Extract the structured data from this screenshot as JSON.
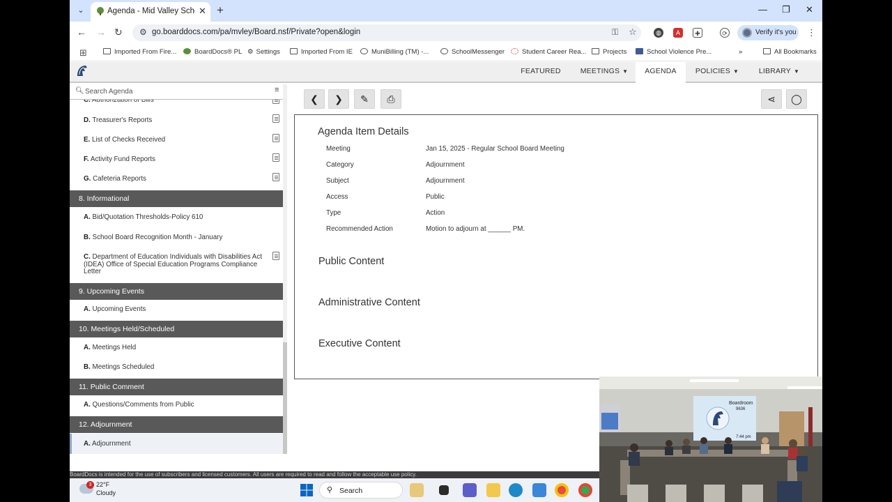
{
  "browser": {
    "tab_title": "Agenda - Mid Valley School Di",
    "url": "go.boarddocs.com/pa/mvley/Board.nsf/Private?open&login",
    "verify_label": "Verify it's you",
    "bookmarks": [
      "Imported From Fire...",
      "BoardDocs® PL",
      "Settings",
      "Imported From IE",
      "MuniBilling (TM) -...",
      "SchoolMessenger",
      "Student Career Rea...",
      "Projects",
      "School Violence Pre..."
    ],
    "all_bookmarks": "All Bookmarks"
  },
  "header": {
    "nav": [
      {
        "label": "FEATURED",
        "chevron": false
      },
      {
        "label": "MEETINGS",
        "chevron": true
      },
      {
        "label": "AGENDA",
        "chevron": false
      },
      {
        "label": "POLICIES",
        "chevron": true
      },
      {
        "label": "LIBRARY",
        "chevron": true
      }
    ],
    "active": "AGENDA"
  },
  "sidebar": {
    "search_placeholder": "Search Agenda",
    "cut_item": {
      "letter": "C.",
      "label": "Authorization of Bills"
    },
    "items": [
      {
        "type": "item",
        "letter": "D.",
        "label": "Treasurer's Reports",
        "doc": true
      },
      {
        "type": "item",
        "letter": "E.",
        "label": "List of Checks Received",
        "doc": true
      },
      {
        "type": "item",
        "letter": "F.",
        "label": "Activity Fund Reports",
        "doc": true
      },
      {
        "type": "item",
        "letter": "G.",
        "label": "Cafeteria Reports",
        "doc": true
      },
      {
        "type": "section",
        "label": "8. Informational"
      },
      {
        "type": "item",
        "letter": "A.",
        "label": "Bid/Quotation Thresholds-Policy 610",
        "doc": false
      },
      {
        "type": "item",
        "letter": "B.",
        "label": "School Board Recognition Month - January",
        "doc": false
      },
      {
        "type": "item",
        "letter": "C.",
        "label": "Department of Education Individuals with Disabilities Act (IDEA) Office of Special Education Programs Compliance Letter",
        "doc": true
      },
      {
        "type": "section",
        "label": "9. Upcoming Events"
      },
      {
        "type": "item",
        "letter": "A.",
        "label": "Upcoming Events",
        "doc": false
      },
      {
        "type": "section",
        "label": "10. Meetings Held/Scheduled"
      },
      {
        "type": "item",
        "letter": "A.",
        "label": "Meetings Held",
        "doc": false
      },
      {
        "type": "item",
        "letter": "B.",
        "label": "Meetings Scheduled",
        "doc": false
      },
      {
        "type": "section",
        "label": "11. Public Comment"
      },
      {
        "type": "item",
        "letter": "A.",
        "label": "Questions/Comments from Public",
        "doc": false
      },
      {
        "type": "section",
        "label": "12. Adjournment"
      },
      {
        "type": "item",
        "letter": "A.",
        "label": "Adjournment",
        "doc": false,
        "selected": true
      }
    ]
  },
  "detail": {
    "title": "Agenda Item Details",
    "rows": [
      {
        "key": "Meeting",
        "value": "Jan 15, 2025 - Regular School Board Meeting"
      },
      {
        "key": "Category",
        "value": "Adjournment"
      },
      {
        "key": "Subject",
        "value": "Adjournment"
      },
      {
        "key": "Access",
        "value": "Public"
      },
      {
        "key": "Type",
        "value": "Action"
      },
      {
        "key": "Recommended Action",
        "value": "Motion to adjourn at ______ PM."
      }
    ],
    "public_content": "Public Content",
    "administrative_content": "Administrative Content",
    "executive_content": "Executive Content"
  },
  "footer": {
    "notice": "BoardDocs is intended for the use of subscribers and licensed customers. All users are required to read and follow the acceptable use policy."
  },
  "taskbar": {
    "weather_temp": "22°F",
    "weather_desc": "Cloudy",
    "weather_badge": "3",
    "search_label": "Search"
  },
  "video": {
    "screen_title": "Boardroom",
    "screen_code": "9636",
    "screen_time": "7:44 pm"
  },
  "colors": {
    "section_bg": "#595959",
    "tab_strip": "#d3e3fd",
    "header_bg": "#efefef"
  }
}
